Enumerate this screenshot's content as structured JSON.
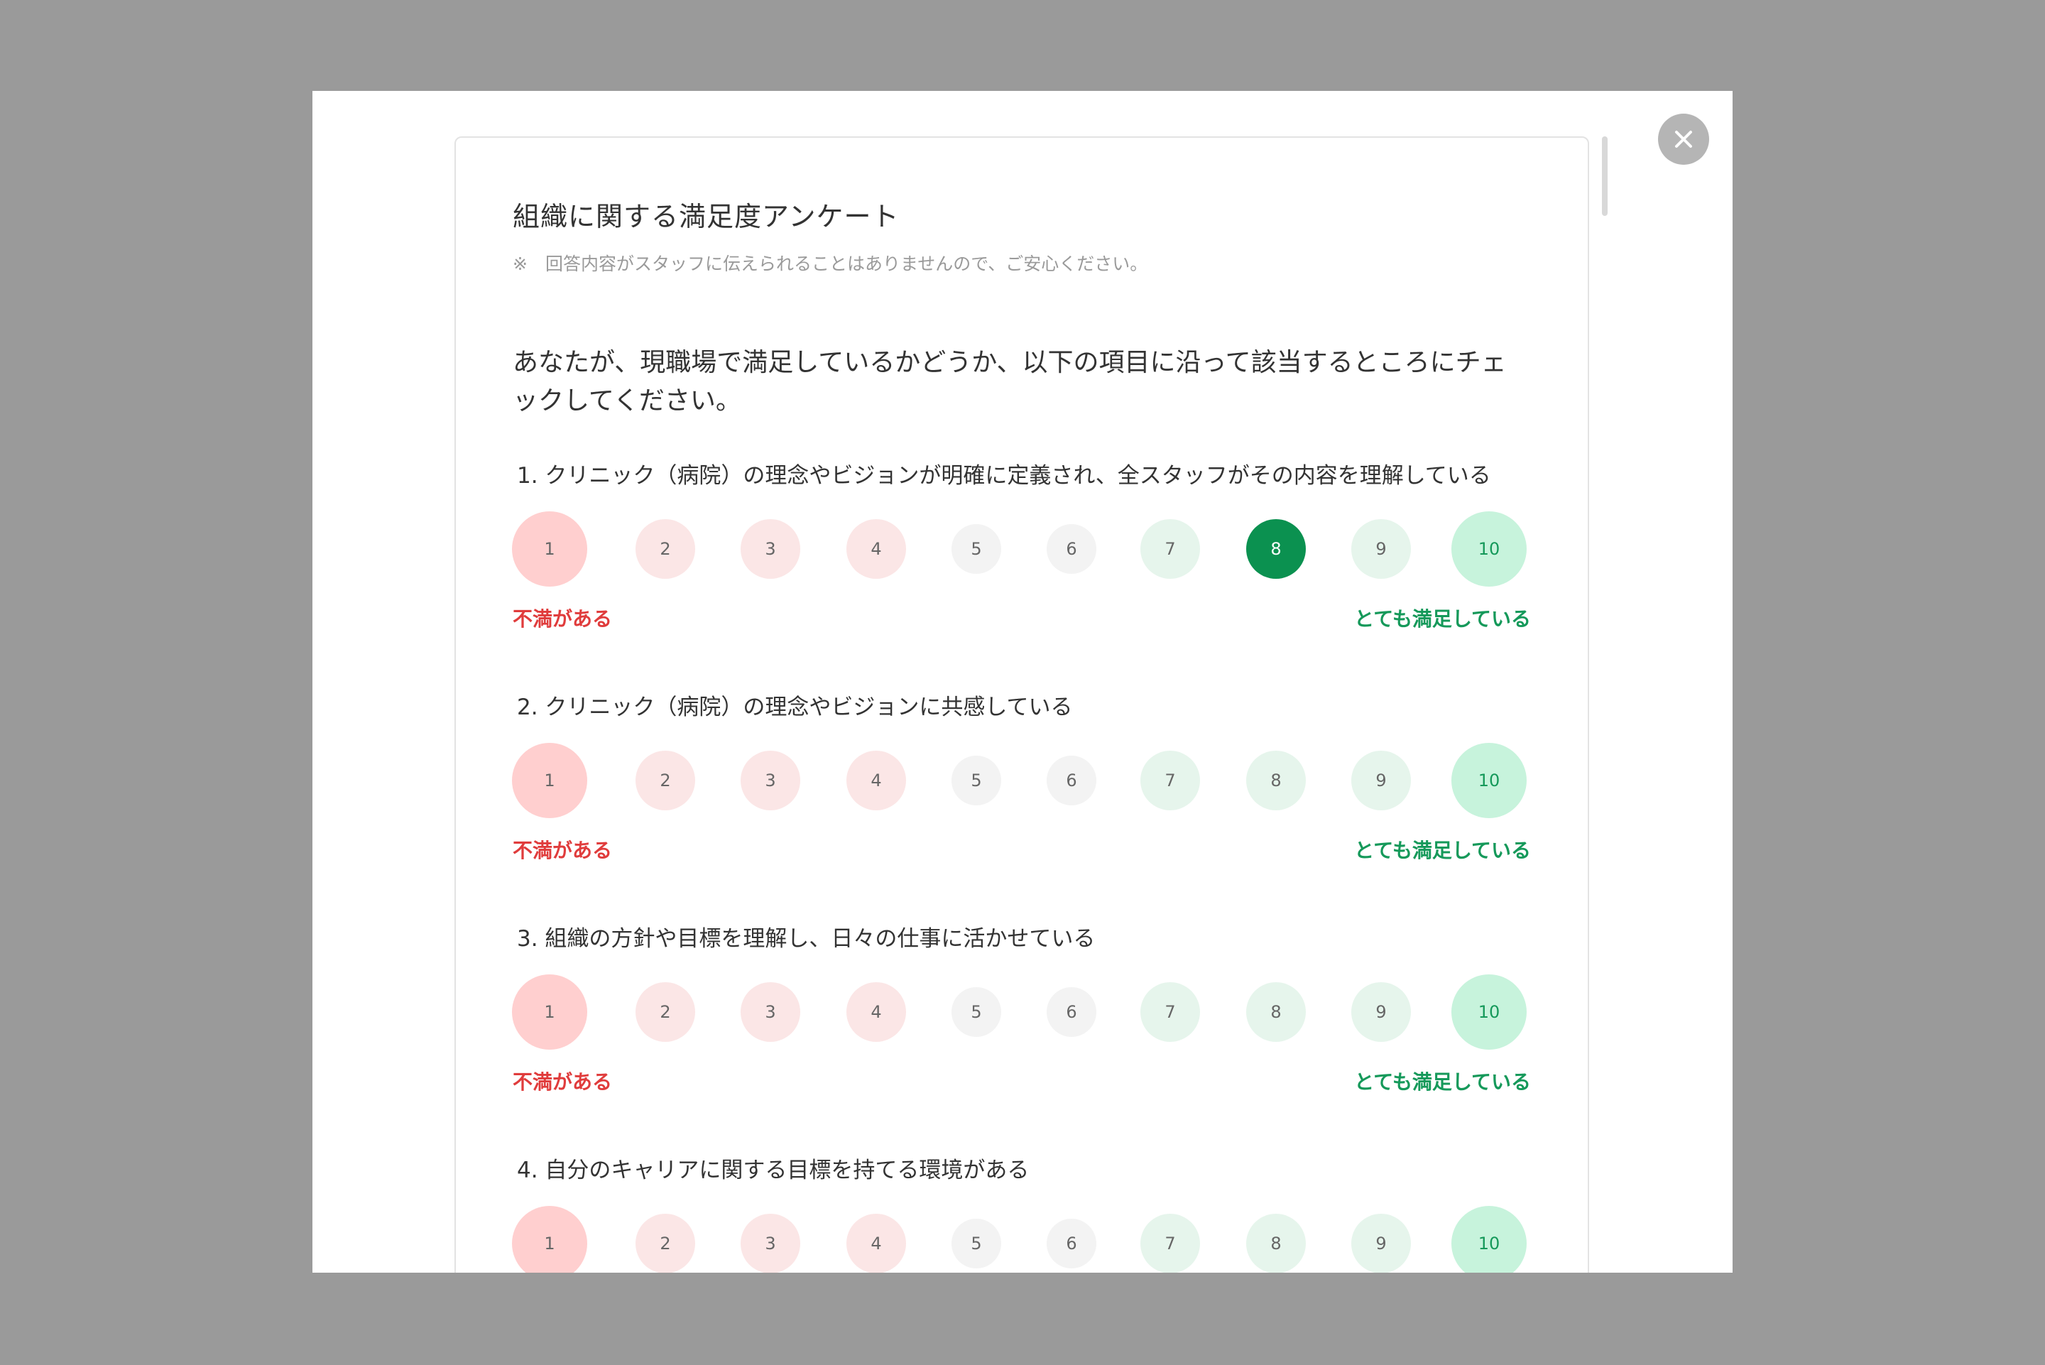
{
  "survey": {
    "title": "組織に関する満足度アンケート",
    "note": "※　回答内容がスタッフに伝えられることはありませんので、ご安心ください。",
    "intro": "あなたが、現職場で満足しているかどうか、以下の項目に沿って該当するところにチェックしてください。",
    "scale_options": [
      "1",
      "2",
      "3",
      "4",
      "5",
      "6",
      "7",
      "8",
      "9",
      "10"
    ],
    "low_label": "不満がある",
    "high_label": "とても満足している",
    "questions": [
      {
        "text": "1. クリニック（病院）の理念やビジョンが明確に定義され、全スタッフがその内容を理解している",
        "selected": 8
      },
      {
        "text": "2. クリニック（病院）の理念やビジョンに共感している",
        "selected": null
      },
      {
        "text": "3. 組織の方針や目標を理解し、日々の仕事に活かせている",
        "selected": null
      },
      {
        "text": "4. 自分のキャリアに関する目標を持てる環境がある",
        "selected": null
      }
    ]
  },
  "colors": {
    "selected": "#0b9150",
    "low_text": "#e03c3c",
    "high_text": "#15995a"
  },
  "icons": {
    "close": "close-icon"
  }
}
